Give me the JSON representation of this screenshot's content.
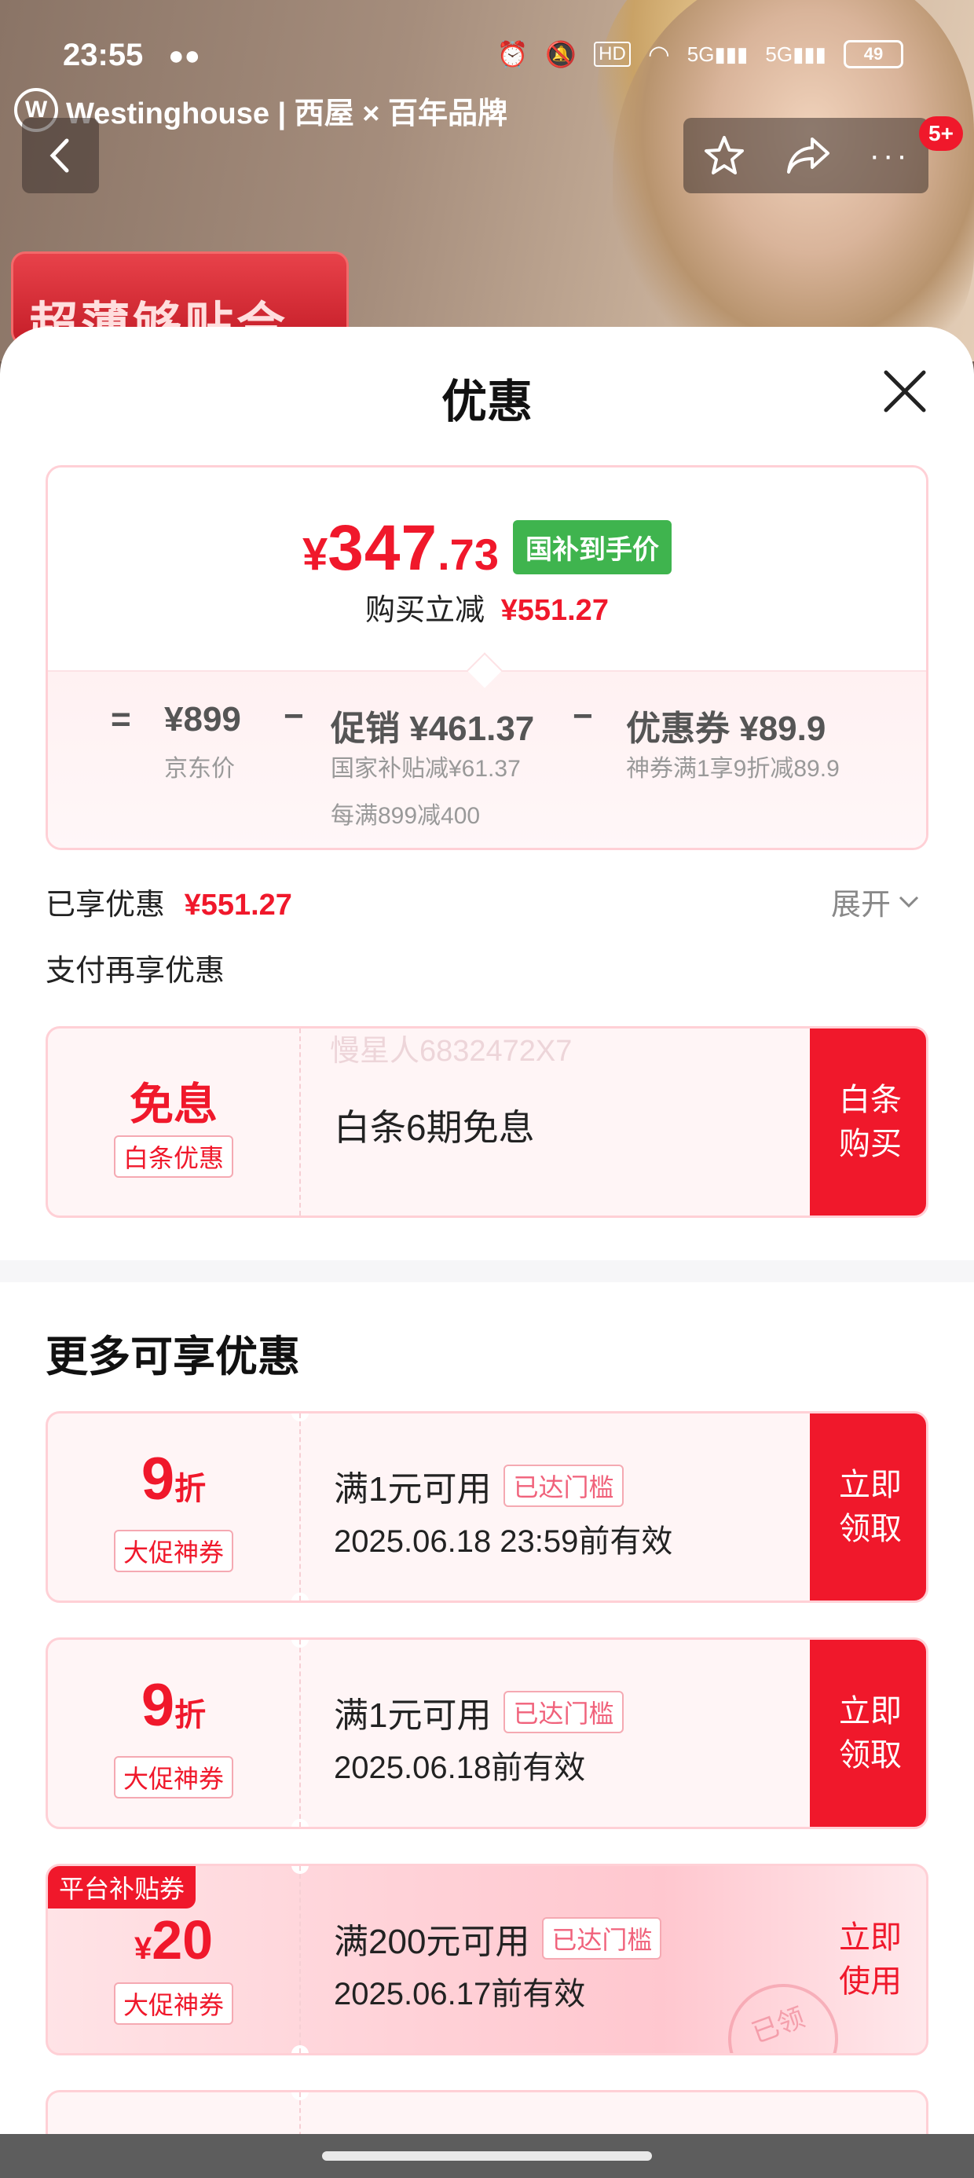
{
  "status_bar": {
    "time": "23:55",
    "network": "5G",
    "battery": "49"
  },
  "brand": {
    "logo_letter": "W",
    "text": "Westinghouse | 西屋 × 百年品牌"
  },
  "header": {
    "cart_badge": "5+"
  },
  "banner": {
    "promo_text": "超薄够贴合"
  },
  "sheet": {
    "title": "优惠"
  },
  "price": {
    "currency": "¥",
    "integer": "347",
    "decimal": ".73",
    "tag": "国补到手价",
    "reduce_label": "购买立减",
    "reduce_value": "¥551.27",
    "eq": "=",
    "jd_price": "¥899",
    "jd_label": "京东价",
    "minus": "−",
    "promo": "促销 ¥461.37",
    "promo_sub1": "国家补贴减¥61.37",
    "promo_sub2": "每满899减400",
    "coupon": "优惠券 ¥89.9",
    "coupon_sub": "神券满1享9折减89.9"
  },
  "enjoyed": {
    "label": "已享优惠",
    "value": "¥551.27",
    "expand": "展开"
  },
  "pay_more": {
    "label": "支付再享优惠"
  },
  "baitiao": {
    "big": "免息",
    "tag": "白条优惠",
    "desc": "白条6期免息",
    "action": "白条购买",
    "watermark": "慢星人6832472X7"
  },
  "more": {
    "title": "更多可享优惠",
    "coupons": [
      {
        "value": "9",
        "unit": "折",
        "tag": "大促神券",
        "title": "满1元可用",
        "reached": "已达门槛",
        "valid": "2025.06.18 23:59前有效",
        "action": "立即领取"
      },
      {
        "value": "9",
        "unit": "折",
        "tag": "大促神券",
        "title": "满1元可用",
        "reached": "已达门槛",
        "valid": "2025.06.18前有效",
        "action": "立即领取"
      },
      {
        "platform": "平台补贴券",
        "currency": "¥",
        "value": "20",
        "tag": "大促神券",
        "title": "满200元可用",
        "reached": "已达门槛",
        "valid": "2025.06.17前有效",
        "action": "立即使用",
        "stamp": "已领"
      }
    ]
  }
}
